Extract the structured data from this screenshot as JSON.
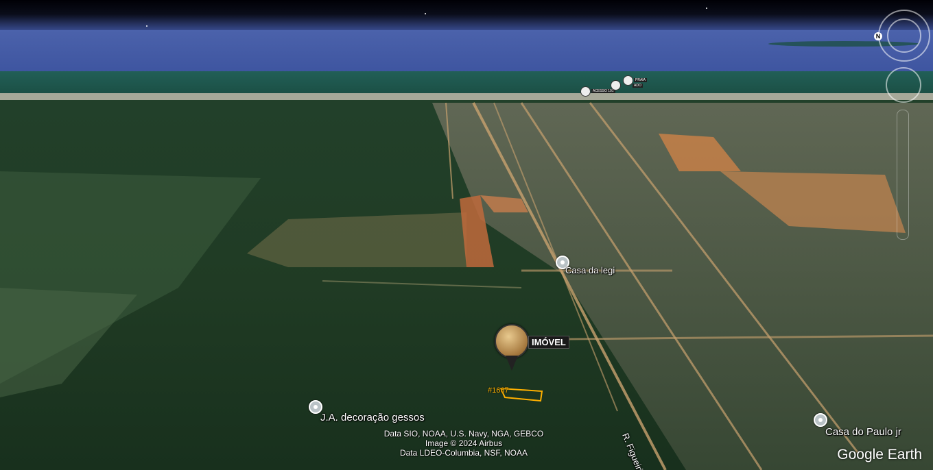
{
  "map": {
    "pois": [
      {
        "label": "Casa da legi"
      },
      {
        "label": "J.A. decoração gessos"
      },
      {
        "label": "Casa do Paulo jr"
      }
    ],
    "property": {
      "label": "IMÓVEL",
      "parcel_id": "#1667"
    },
    "streets": [
      {
        "label": "R. Figueirinha"
      }
    ],
    "coastal_markers": [
      {
        "label": "ACESSO 101"
      },
      {
        "label": "PRAIA"
      },
      {
        "label": "ADO"
      }
    ],
    "credits": [
      "Data SIO, NOAA, U.S. Navy, NGA, GEBCO",
      "Image © 2024 Airbus",
      "Data LDEO-Columbia, NSF, NOAA"
    ],
    "brand": "Google Earth",
    "compass": {
      "north_label": "N"
    },
    "colors": {
      "parcel_outline": "#ffb000",
      "sea": "#1e5c4f",
      "sky": "#4a5da3",
      "forest": "#2a4a2c"
    }
  }
}
